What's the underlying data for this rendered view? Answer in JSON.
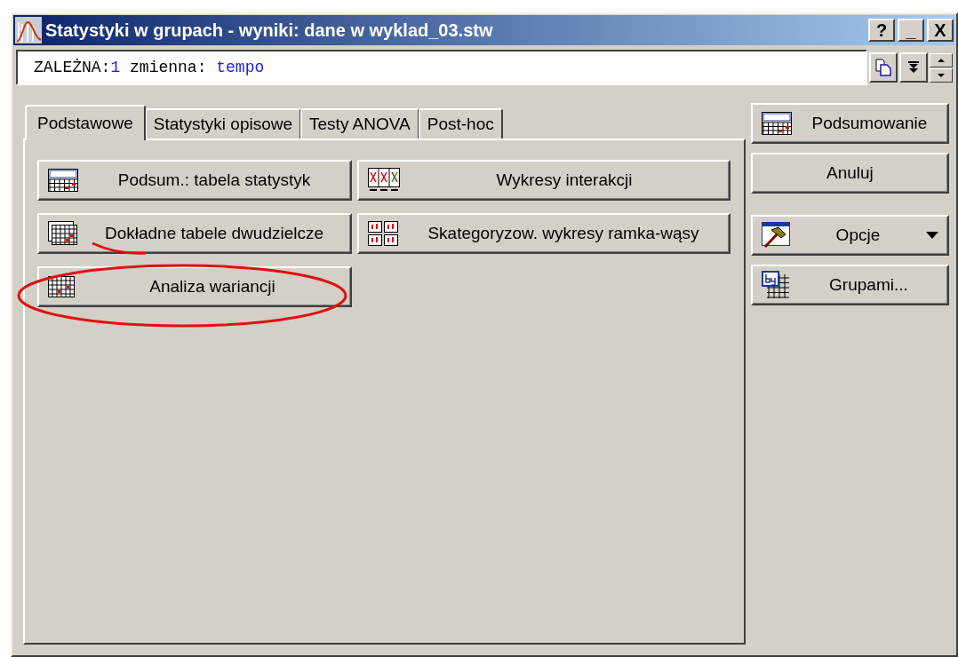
{
  "window": {
    "title": "Statystyki w grupach - wyniki: dane w wyklad_03.stw"
  },
  "title_buttons": [
    "?",
    "_",
    "X"
  ],
  "variables_field": {
    "parts": [
      {
        "text": "ZALEŻNA:",
        "kind": "label"
      },
      {
        "text": "1",
        "kind": "value"
      },
      {
        "text": " zmienna: ",
        "kind": "label"
      },
      {
        "text": "tempo",
        "kind": "value"
      }
    ]
  },
  "tabs": [
    {
      "label": "Podstawowe",
      "selected": true
    },
    {
      "label": "Statystyki opisowe",
      "selected": false
    },
    {
      "label": "Testy ANOVA",
      "selected": false
    },
    {
      "label": "Post-hoc",
      "selected": false
    }
  ],
  "panel_buttons": [
    {
      "label": "Podsum.: tabela statystyk"
    },
    {
      "label": "Wykresy interakcji"
    },
    {
      "label": "Dokładne tabele dwudzielcze"
    },
    {
      "label": "Skategoryzow. wykresy ramka-wąsy"
    },
    {
      "label": "Analiza wariancji"
    }
  ],
  "side_buttons": [
    {
      "label": "Podsumowanie",
      "dropdown": false
    },
    {
      "label": "Anuluj",
      "dropdown": false
    },
    {
      "label": "Opcje",
      "dropdown": true
    },
    {
      "label": "Grupami...",
      "dropdown": false
    }
  ]
}
